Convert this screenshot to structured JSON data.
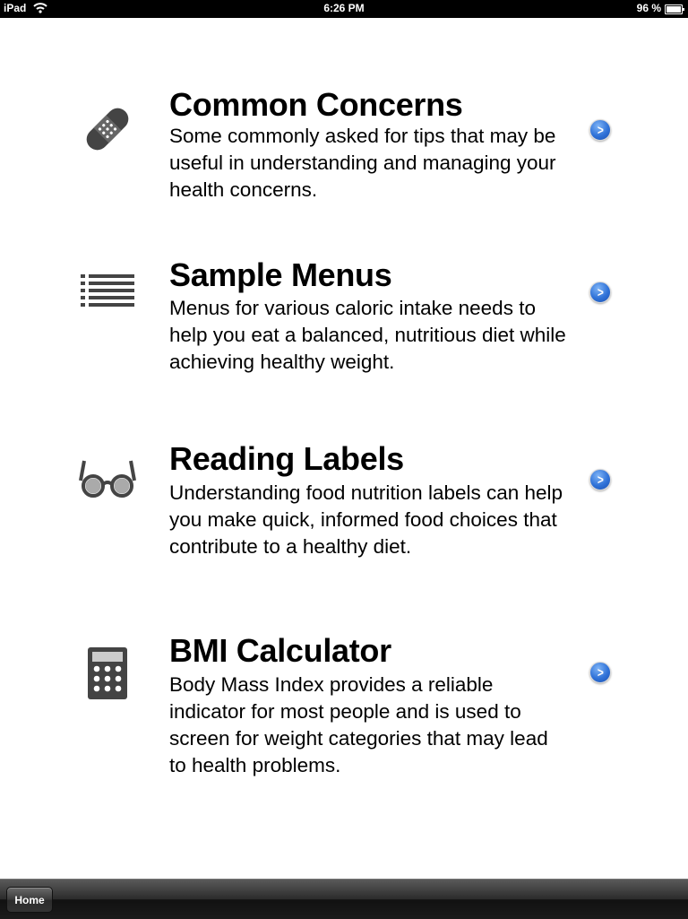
{
  "status_bar": {
    "carrier": "iPad",
    "time": "6:26 PM",
    "battery": "96 %"
  },
  "menu": {
    "items": [
      {
        "title": "Common Concerns",
        "description": "Some commonly asked for tips that may be useful in understanding and managing your health concerns.",
        "icon": "bandage-icon"
      },
      {
        "title": "Sample Menus",
        "description": "Menus for various caloric intake needs to help you eat a balanced, nutritious diet while achieving healthy weight.",
        "icon": "list-icon"
      },
      {
        "title": "Reading Labels",
        "description": "Understanding food nutrition labels can help you make quick, informed food choices that contribute to a healthy diet.",
        "icon": "glasses-icon"
      },
      {
        "title": "BMI Calculator",
        "description": "Body Mass Index provides a reliable indicator for most people and is used to screen for weight categories that may lead to health problems.",
        "icon": "calculator-icon"
      }
    ]
  },
  "toolbar": {
    "home_label": "Home"
  },
  "colors": {
    "disclosure_blue": "#2f72d8",
    "icon_gray": "#444444"
  }
}
